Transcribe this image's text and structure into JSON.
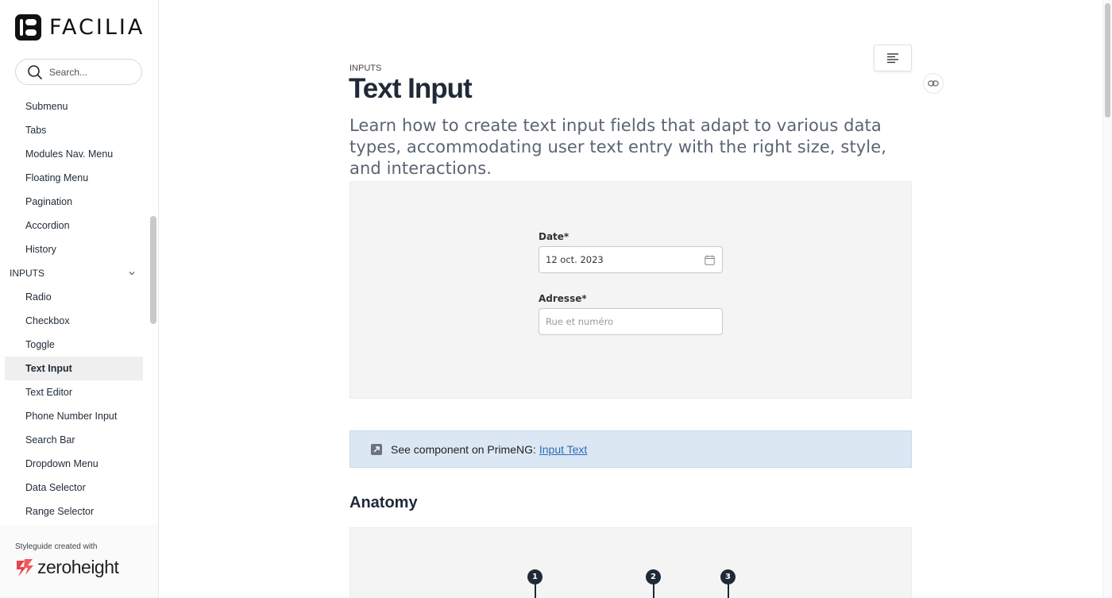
{
  "brand": {
    "name": "FACILIA"
  },
  "search": {
    "placeholder": "Search..."
  },
  "sidebar": {
    "items_before": [
      "Submenu",
      "Tabs",
      "Modules Nav. Menu",
      "Floating Menu",
      "Pagination",
      "Accordion",
      "History"
    ],
    "section": "INPUTS",
    "items_after": [
      "Radio",
      "Checkbox",
      "Toggle",
      "Text Input",
      "Text Editor",
      "Phone Number Input",
      "Search Bar",
      "Dropdown Menu",
      "Data Selector",
      "Range Selector"
    ],
    "active": "Text Input"
  },
  "footer": {
    "created_with": "Styleguide created with",
    "vendor": "zeroheight"
  },
  "page": {
    "eyebrow": "INPUTS",
    "title": "Text Input",
    "lead": "Learn how to create text input fields that adapt to various data types, accommodating user text entry with the right size, style, and interactions."
  },
  "demo": {
    "date_label": "Date*",
    "date_value": "12 oct. 2023",
    "address_label": "Adresse*",
    "address_placeholder": "Rue et numéro"
  },
  "callout": {
    "text": "See component on PrimeNG:",
    "link": "Input Text"
  },
  "anatomy": {
    "heading": "Anatomy",
    "markers": [
      "1",
      "2",
      "3"
    ]
  },
  "colors": {
    "text": "#1f2a37",
    "link": "#2a6db5",
    "callout_bg": "#dbe7f3",
    "active_bg": "#efefef"
  }
}
